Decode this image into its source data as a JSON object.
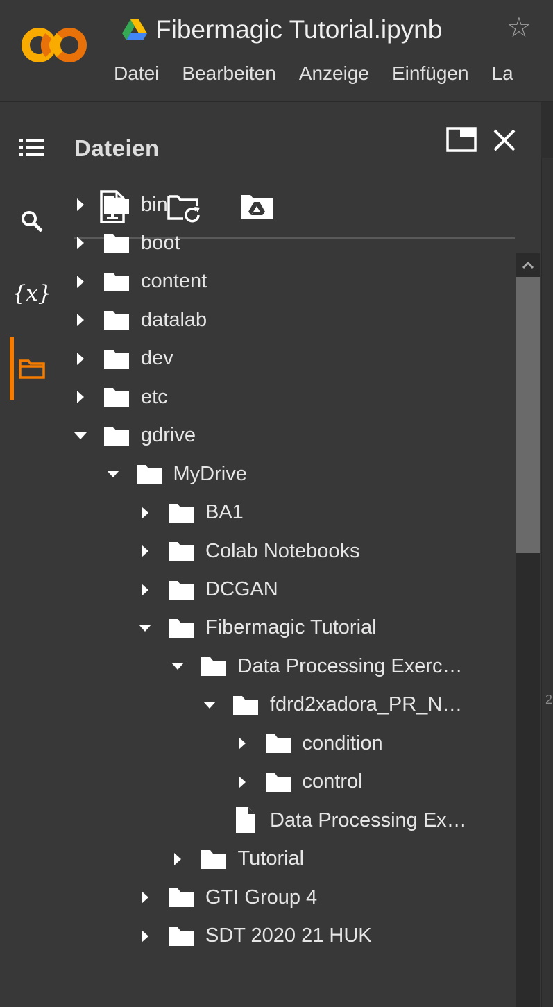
{
  "app": {
    "title": "Fibermagic Tutorial.ipynb",
    "logo": "colab-logo",
    "drive_icon": "google-drive-icon",
    "star_icon": "star-outline-icon"
  },
  "menu": [
    "Datei",
    "Bearbeiten",
    "Anzeige",
    "Einfügen",
    "La"
  ],
  "rail": {
    "items": [
      "table-of-contents-icon",
      "search-icon",
      "variables-icon",
      "folder-icon"
    ],
    "variables_glyph": "{x}",
    "active": "folder-icon",
    "accent_color": "#f57c00"
  },
  "panel": {
    "title": "Dateien",
    "actions": [
      "upload-file-icon",
      "refresh-folder-icon",
      "mount-drive-icon"
    ]
  },
  "tree": [
    {
      "label": "bin",
      "type": "folder",
      "expanded": false
    },
    {
      "label": "boot",
      "type": "folder",
      "expanded": false
    },
    {
      "label": "content",
      "type": "folder",
      "expanded": false
    },
    {
      "label": "datalab",
      "type": "folder",
      "expanded": false
    },
    {
      "label": "dev",
      "type": "folder",
      "expanded": false
    },
    {
      "label": "etc",
      "type": "folder",
      "expanded": false
    },
    {
      "label": "gdrive",
      "type": "folder",
      "expanded": true
    },
    {
      "label": "MyDrive",
      "type": "folder",
      "expanded": true
    },
    {
      "label": "BA1",
      "type": "folder",
      "expanded": false
    },
    {
      "label": "Colab Notebooks",
      "type": "folder",
      "expanded": false
    },
    {
      "label": "DCGAN",
      "type": "folder",
      "expanded": false
    },
    {
      "label": "Fibermagic Tutorial",
      "type": "folder",
      "expanded": true
    },
    {
      "label": "Data Processing Exerc…",
      "type": "folder",
      "expanded": true
    },
    {
      "label": "fdrd2xadora_PR_N…",
      "type": "folder",
      "expanded": true
    },
    {
      "label": "condition",
      "type": "folder",
      "expanded": false
    },
    {
      "label": "control",
      "type": "folder",
      "expanded": false
    },
    {
      "label": "Data Processing Ex…",
      "type": "file"
    },
    {
      "label": "Tutorial",
      "type": "folder",
      "expanded": false
    },
    {
      "label": "GTI Group 4",
      "type": "folder",
      "expanded": false
    },
    {
      "label": "SDT 2020 21 HUK",
      "type": "folder",
      "expanded": false
    }
  ],
  "edge_text": "2"
}
